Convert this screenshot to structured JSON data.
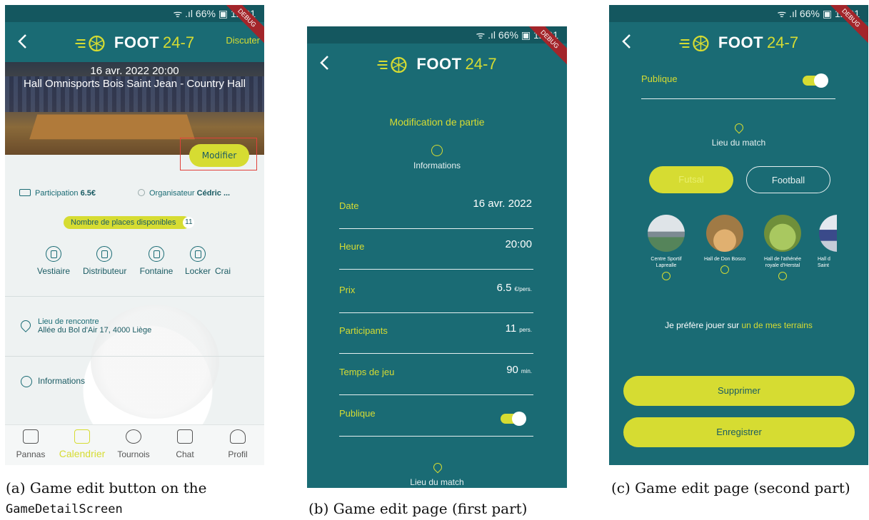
{
  "status": {
    "text": "ᯤ .ıl 66% ▣ 12:01"
  },
  "brand": {
    "name": "FOOT",
    "num": "24-7",
    "debug": "DEBUG",
    "accent": "#d6dc32",
    "teal": "#1a6b74"
  },
  "screen_a": {
    "discuter": "Discuter",
    "date": "16 avr. 2022 20:00",
    "place": "Hall Omnisports Bois Saint Jean - Country Hall",
    "modifier": "Modifier",
    "participation_label": "Participation",
    "participation_value": "6.5€",
    "organisateur_label": "Organisateur",
    "organisateur_value": "Cédric ...",
    "places_label": "Nombre de places disponibles",
    "places_count": "11",
    "amenities": [
      "Vestiaire",
      "Distributeur",
      "Fontaine",
      "Locker",
      "Crai"
    ],
    "lieu_title": "Lieu de rencontre",
    "lieu_addr": "Allée du Bol d'Air 17, 4000 Liège",
    "informations": "Informations",
    "nav": [
      "Pannas",
      "Calendrier",
      "Tournois",
      "Chat",
      "Profil"
    ]
  },
  "screen_b": {
    "title": "Modification de partie",
    "informations": "Informations",
    "fields": [
      {
        "label": "Date",
        "value": "16 avr. 2022",
        "unit": ""
      },
      {
        "label": "Heure",
        "value": "20:00",
        "unit": ""
      },
      {
        "label": "Prix",
        "value": "6.5",
        "unit": "€/pers."
      },
      {
        "label": "Participants",
        "value": "11",
        "unit": "pers."
      },
      {
        "label": "Temps de jeu",
        "value": "90",
        "unit": "min."
      }
    ],
    "publique": "Publique",
    "lieu": "Lieu du match"
  },
  "screen_c": {
    "publique": "Publique",
    "lieu": "Lieu du match",
    "seg_on": "Futsal",
    "seg_off": "Football",
    "venues": [
      {
        "name": "Centre Sportif Laprealle"
      },
      {
        "name": "Hall de Don Bosco"
      },
      {
        "name": "Hall de l'athénée royale d'Herstal"
      },
      {
        "name": "Hall d Saint"
      }
    ],
    "pref_text": "Je préfère jouer sur",
    "pref_link": "un de mes terrains",
    "supprimer": "Supprimer",
    "enregistrer": "Enregistrer"
  },
  "captions": {
    "a_prefix": "(a) Game edit button on the",
    "a_code": "GameDetailScreen",
    "b": "(b) Game edit page (first part)",
    "c": "(c) Game edit page (second part)"
  }
}
